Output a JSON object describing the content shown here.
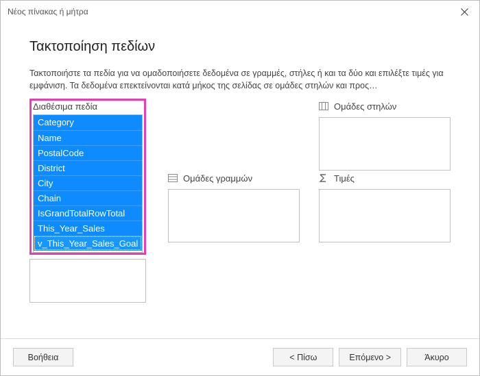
{
  "window": {
    "title": "Νέος πίνακας ή μήτρα"
  },
  "page": {
    "heading": "Τακτοποίηση πεδίων",
    "description": "Τακτοποιήστε τα πεδία για να ομαδοποιήσετε δεδομένα σε γραμμές, στήλες ή και τα δύο και επιλέξτε τιμές για εμφάνιση. Τα δεδομένα επεκτείνονται κατά μήκος της σελίδας σε ομάδες στηλών και προς…"
  },
  "labels": {
    "available": "Διαθέσιμα πεδία",
    "colGroups": "Ομάδες στηλών",
    "rowGroups": "Ομάδες γραμμών",
    "values": "Τιμές"
  },
  "fields": {
    "available": [
      "Category",
      "Name",
      "PostalCode",
      "District",
      "City",
      "Chain",
      "IsGrandTotalRowTotal",
      "This_Year_Sales",
      "v_This_Year_Sales_Goal"
    ]
  },
  "buttons": {
    "help": "Βοήθεια",
    "back": "<  Πίσω",
    "next": "Επόμενο >",
    "cancel": "Άκυρο"
  }
}
